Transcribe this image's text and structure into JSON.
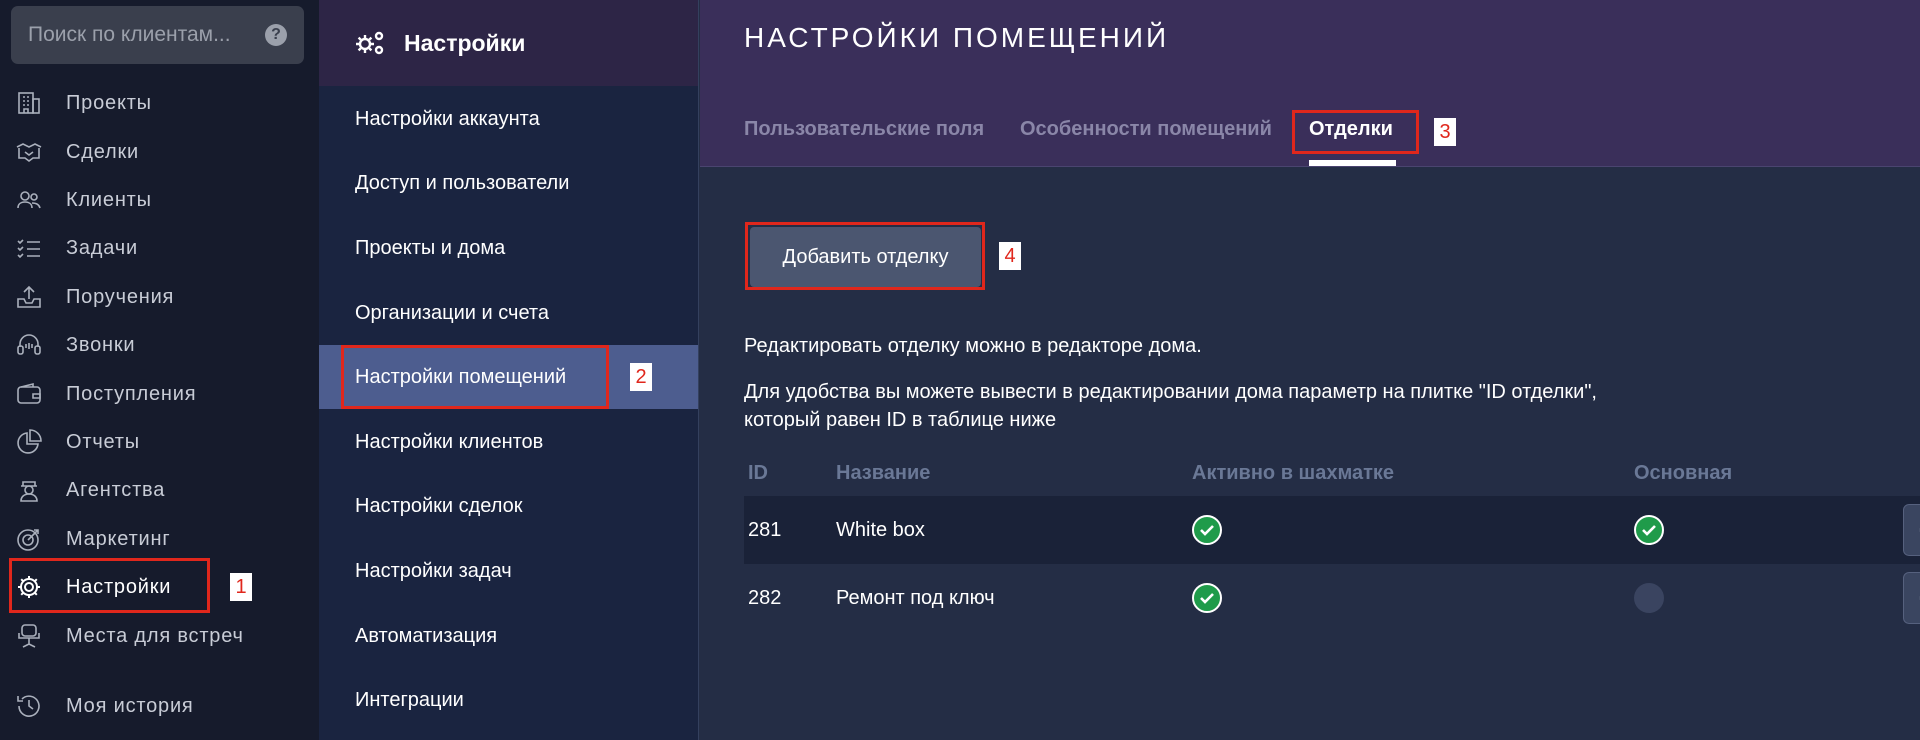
{
  "search": {
    "placeholder": "Поиск по клиентам..."
  },
  "sidebar": {
    "items": [
      {
        "label": "Проекты",
        "icon": "building-icon"
      },
      {
        "label": "Сделки",
        "icon": "handshake-icon"
      },
      {
        "label": "Клиенты",
        "icon": "users-icon"
      },
      {
        "label": "Задачи",
        "icon": "tasks-icon"
      },
      {
        "label": "Поручения",
        "icon": "inbox-upload-icon"
      },
      {
        "label": "Звонки",
        "icon": "headset-icon"
      },
      {
        "label": "Поступления",
        "icon": "wallet-icon"
      },
      {
        "label": "Отчеты",
        "icon": "pie-chart-icon"
      },
      {
        "label": "Агентства",
        "icon": "agent-icon"
      },
      {
        "label": "Маркетинг",
        "icon": "target-icon"
      },
      {
        "label": "Настройки",
        "icon": "gear-icon"
      },
      {
        "label": "Места для встреч",
        "icon": "chair-icon"
      },
      {
        "label": "Моя история",
        "icon": "history-icon"
      }
    ]
  },
  "settings": {
    "title": "Настройки",
    "items": [
      "Настройки аккаунта",
      "Доступ и пользователи",
      "Проекты и дома",
      "Организации и счета",
      "Настройки помещений",
      "Настройки клиентов",
      "Настройки сделок",
      "Настройки задач",
      "Автоматизация",
      "Интеграции"
    ]
  },
  "main": {
    "title": "НАСТРОЙКИ ПОМЕЩЕНИЙ",
    "tabs": [
      "Пользовательские поля",
      "Особенности помещений",
      "Отделки"
    ],
    "add_button": "Добавить отделку",
    "info_1": "Редактировать отделку можно в редакторе дома.",
    "info_2": "Для удобства вы можете вывести в редактировании дома параметр на плитке \"ID отделки\",",
    "info_3": "который равен ID в таблице ниже",
    "table": {
      "columns": [
        "ID",
        "Название",
        "Активно в шахматке",
        "Основная"
      ],
      "rows": [
        {
          "id": "281",
          "name": "White box",
          "active": true,
          "main": true
        },
        {
          "id": "282",
          "name": "Ремонт под ключ",
          "active": true,
          "main": false
        }
      ]
    }
  },
  "annotations": [
    "1",
    "2",
    "3",
    "4"
  ],
  "colors": {
    "annotation": "#e0271c",
    "check": "#1f9b4a",
    "active_menu": "#4d5d8f"
  }
}
